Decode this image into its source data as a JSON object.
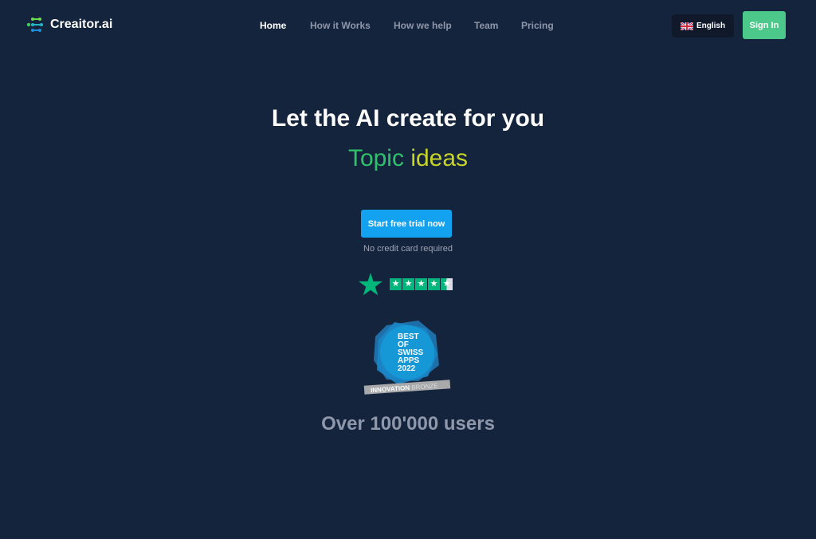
{
  "header": {
    "logo_text": "Creaitor.ai",
    "nav": [
      {
        "label": "Home",
        "active": true
      },
      {
        "label": "How it Works",
        "active": false
      },
      {
        "label": "How we help",
        "active": false
      },
      {
        "label": "Team",
        "active": false
      },
      {
        "label": "Pricing",
        "active": false
      }
    ],
    "language": {
      "label": "English",
      "flag_icon": "uk-flag-icon"
    },
    "signin_label": "Sign In"
  },
  "hero": {
    "title": "Let the AI create for you",
    "subtitle_word1": "Topic",
    "subtitle_word2": "ideas",
    "cta_label": "Start free trial now",
    "cta_note": "No credit card required",
    "rating": {
      "stars": 4.5,
      "max": 5,
      "icon": "trustpilot-star-icon"
    },
    "badge": {
      "lines": [
        "BEST",
        "OF",
        "SWISS",
        "APPS",
        "2022"
      ],
      "ribbon_strong": "INNOVATION",
      "ribbon_light": "BRONZE"
    },
    "users_text": "Over 100'000 users"
  },
  "colors": {
    "background": "#15243d",
    "accent_green": "#4cc98a",
    "cta_blue": "#12a2f0",
    "trustpilot_green": "#00b67a"
  }
}
